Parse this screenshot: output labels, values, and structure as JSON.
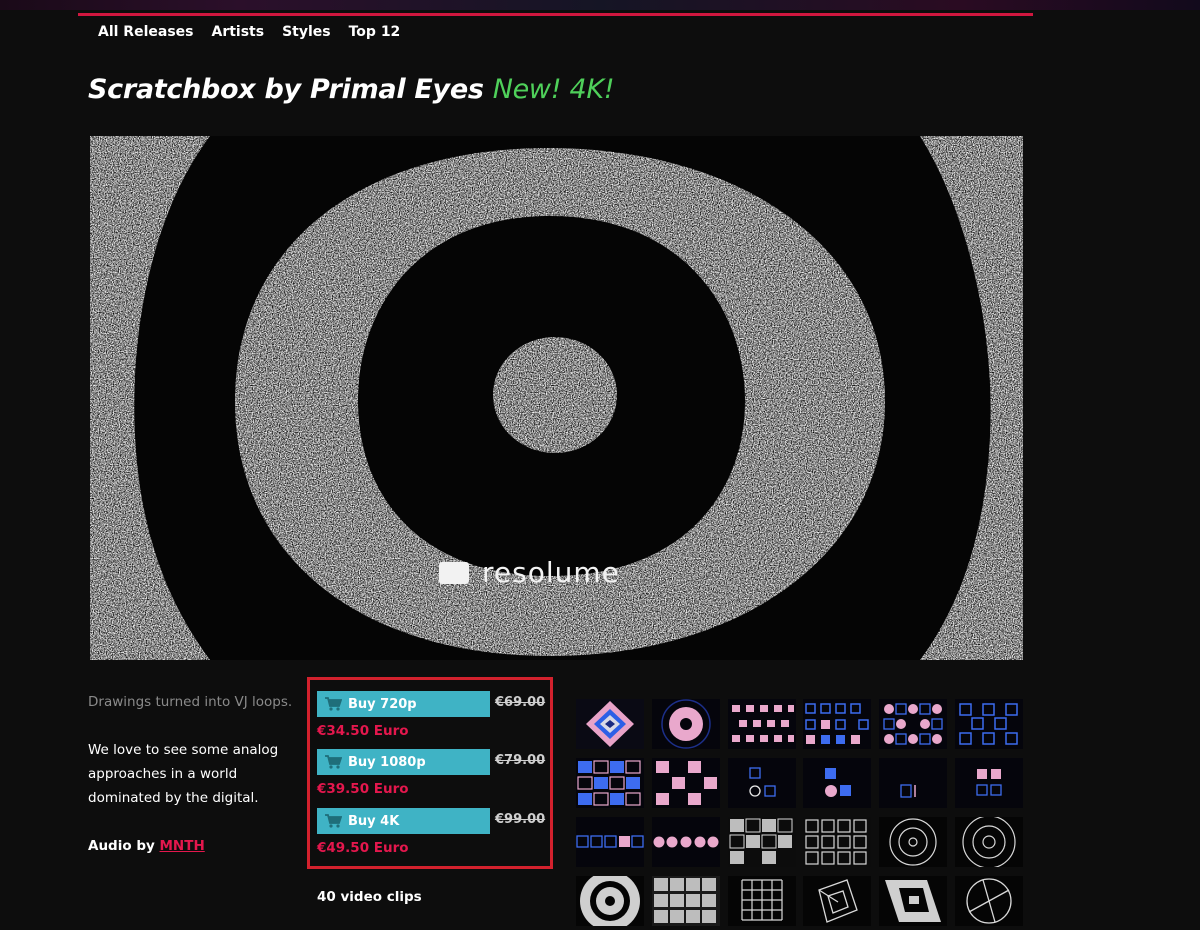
{
  "subnav": {
    "items": [
      "All Releases",
      "Artists",
      "Styles",
      "Top 12"
    ]
  },
  "page": {
    "title": "Scratchbox by Primal Eyes",
    "badge": "New! 4K!",
    "accent_color": "#d0173f",
    "badge_color": "#4fd05a"
  },
  "video": {
    "watermark": "resolume"
  },
  "description": {
    "lead": "Drawings turned into VJ loops.",
    "body": "We love to see some analog approaches in a world dominated by the digital.",
    "audio_prefix": "Audio by",
    "audio_link": "MNTH"
  },
  "purchase": {
    "options": [
      {
        "label": "Buy 720p",
        "old_price": "€69.00",
        "price": "€34.50 Euro"
      },
      {
        "label": "Buy 1080p",
        "old_price": "€79.00",
        "price": "€39.50 Euro"
      },
      {
        "label": "Buy 4K",
        "old_price": "€99.00",
        "price": "€49.50 Euro"
      }
    ],
    "button_color": "#3fb3c5",
    "price_color": "#e4174d"
  },
  "clips_count": "40 video clips",
  "thumbnails": [
    "spiral-square-blue-pink",
    "pink-donut",
    "pink-dot-grid",
    "blue-square-grid",
    "pink-circle-grid",
    "blue-outline-grid",
    "blue-checker",
    "pink-checker",
    "small-square-pair",
    "blue-square-pink-dot",
    "single-square-outline",
    "pink-square-cluster",
    "square-row-outline",
    "pink-dot-row",
    "white-scribble-grid",
    "white-square-grid",
    "concentric-rings",
    "concentric-rings-large",
    "white-donut",
    "white-cell-grid",
    "white-line-grid",
    "rotated-squares",
    "diagonal-square-split",
    "quartered-circle"
  ]
}
